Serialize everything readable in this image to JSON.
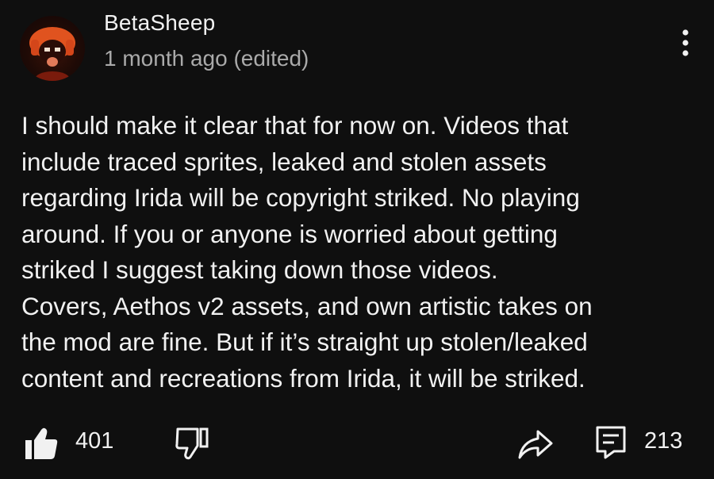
{
  "comment": {
    "author": "BetaSheep",
    "timestamp": "1 month ago (edited)",
    "body_lines": [
      "I should make it clear that for now on. Videos that",
      "include traced sprites, leaked and stolen assets",
      "regarding Irida will be copyright striked. No playing",
      "around. If you or anyone is worried about getting",
      "striked I suggest taking down those videos.",
      "Covers, Aethos v2 assets, and own artistic takes on",
      "the mod are fine. But if it’s straight up stolen/leaked",
      "content and recreations from Irida, it will be striked."
    ],
    "like_count": "401",
    "reply_count": "213"
  },
  "icons": {
    "avatar": "avatar-image",
    "menu": "more-vertical-icon",
    "like": "thumbs-up-filled-icon",
    "dislike": "thumbs-down-outline-icon",
    "share": "share-arrow-icon",
    "reply": "comment-reply-icon"
  },
  "colors": {
    "background": "#0f0f0f",
    "text_primary": "#f1f1f1",
    "text_secondary": "#aaaaaa",
    "avatar_orange": "#e0531f"
  }
}
